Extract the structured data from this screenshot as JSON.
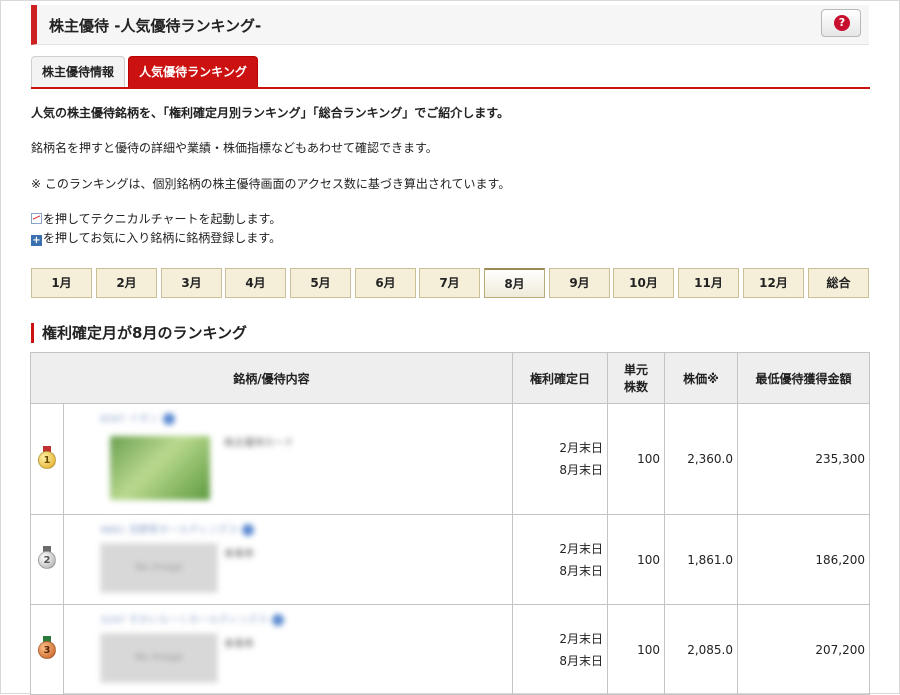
{
  "header": {
    "title": "株主優待 -人気優待ランキング-",
    "help_label": "?"
  },
  "tabs": [
    {
      "label": "株主優待情報",
      "active": false
    },
    {
      "label": "人気優待ランキング",
      "active": true
    }
  ],
  "intro": {
    "line1": "人気の株主優待銘柄を、「権利確定月別ランキング」「総合ランキング」でご紹介します。",
    "line2": "銘柄名を押すと優待の詳細や業績・株価指標などもあわせて確認できます。",
    "line3": "※ このランキングは、個別銘柄の株主優待画面のアクセス数に基づき算出されています。",
    "line4": "を押してテクニカルチャートを起動します。",
    "line5": "を押してお気に入り銘柄に銘柄登録します。",
    "chart_icon": "chart-icon",
    "plus_icon": "plus-icon"
  },
  "months": [
    "1月",
    "2月",
    "3月",
    "4月",
    "5月",
    "6月",
    "7月",
    "8月",
    "9月",
    "10月",
    "11月",
    "12月",
    "総合"
  ],
  "active_month": "8月",
  "section_title": "権利確定月が8月のランキング",
  "table": {
    "headers": {
      "name": "銘柄/優待内容",
      "date": "権利確定日",
      "unit": "単元株数",
      "unit_l1": "単元",
      "unit_l2": "株数",
      "price": "株価※",
      "min": "最低優待獲得金額"
    },
    "rows": [
      {
        "rank": "1",
        "code": "8267",
        "name": "イオン",
        "benefit": "株主優待カード",
        "image": "",
        "date1": "2月末日",
        "date2": "8月末日",
        "unit": "100",
        "price": "2,360.0",
        "min": "235,300"
      },
      {
        "rank": "2",
        "code": "9861",
        "name": "吉野家ホールディングス",
        "benefit": "食事券",
        "image": "No Image",
        "date1": "2月末日",
        "date2": "8月末日",
        "unit": "100",
        "price": "1,861.0",
        "min": "186,200"
      },
      {
        "rank": "3",
        "code": "3197",
        "name": "すかいらーくホールディングス",
        "benefit": "食事券",
        "image": "No Image",
        "date1": "2月末日",
        "date2": "8月末日",
        "unit": "100",
        "price": "2,085.0",
        "min": "207,200"
      }
    ]
  },
  "colors": {
    "accent": "#cc1111",
    "month_bg": "#f5efd9",
    "header_bg": "#eeeeee"
  }
}
